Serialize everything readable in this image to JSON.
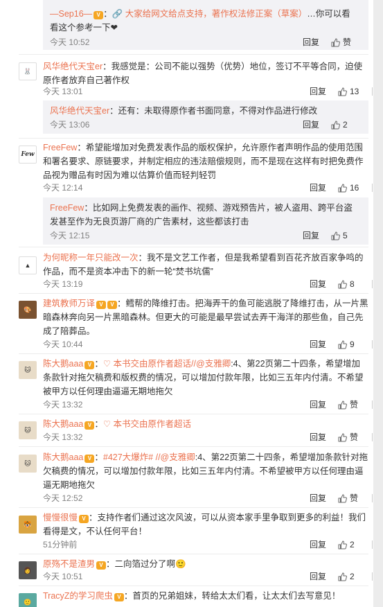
{
  "comments": [
    {
      "id": "c0-sub",
      "is_sub": true,
      "user": "—Sep16—",
      "link": "🔗 大家给网文给点支持，著作权法修正案（草案）",
      "text": "…你可以看看这个参考一下❤",
      "time": "今天 10:52",
      "reply": "回复",
      "likes": "赞"
    },
    {
      "id": "c1",
      "user": "风华绝代天宝er",
      "text": "：我感觉是：公司不能以强势（优势）地位，签订不平等合同，迫使原作者放弃自己著作权",
      "time": "今天 13:01",
      "reply": "回复",
      "likes": "13"
    },
    {
      "id": "c1-sub",
      "is_sub": true,
      "user": "风华绝代天宝er",
      "text": "：还有：未取得原作者书面同意，不得对作品进行修改",
      "time": "今天 13:06",
      "reply": "回复",
      "likes": "2"
    },
    {
      "id": "c2",
      "user": "FreeFew",
      "text": "：希望能增加对免费发表作品的版权保护，允许原作者声明作品的使用范围和署名要求、原链要求，并制定相应的违法赔偿规则，而不是现在这样有时把免费作品视为赠品有时因为难以估算价值而轻判轻罚",
      "time": "今天 12:14",
      "reply": "回复",
      "likes": "16"
    },
    {
      "id": "c2-sub",
      "is_sub": true,
      "user": "FreeFew",
      "text": "：比如网上免费发表的画作、视频、游戏预告片，被人盗用、跨平台盗发甚至作为无良页游厂商的广告素材，这些都该打击",
      "time": "今天 12:15",
      "reply": "回复",
      "likes": "5"
    },
    {
      "id": "c3",
      "user": "为何昵称一年只能改一次",
      "text": "：我不是文艺工作者，但是我希望看到百花齐放百家争鸣的作品，而不是资本冲击下的新一轮“焚书坑儒”",
      "time": "今天 13:19",
      "reply": "回复",
      "likes": "8"
    },
    {
      "id": "c4",
      "user": "建筑教师万译",
      "text": "：鳕帮的降维打击。把海弄干的鱼可能逃脱了降维打击，从一片黑暗森林奔向另一片黑暗森林。但更大的可能是最早尝试去弄干海洋的那些鱼，自己先成了陪葬品。",
      "time": "今天 10:44",
      "reply": "回复",
      "likes": "9"
    },
    {
      "id": "c5",
      "user": "陈大鹅aaa",
      "link": "♡ 本书交由原作者超话//@支雅卿",
      "text": ":4、第22页第二十四条，希望增加条款针对拖欠稿费和版权费的情况，可以增加付款年限，比如三五年内付清。不希望被甲方以任何理由逼逼无期地拖欠",
      "time": "今天 13:32",
      "reply": "回复",
      "likes": "赞"
    },
    {
      "id": "c6",
      "user": "陈大鹅aaa",
      "link": "♡ 本书交由原作者超话",
      "text": "",
      "time": "今天 13:32",
      "reply": "回复",
      "likes": "赞"
    },
    {
      "id": "c7",
      "user": "陈大鹅aaa",
      "link": "#427大爆炸# //@支雅卿",
      "text": ":4、第22页第二十四条，希望增加条款针对拖欠稿费的情况，可以增加付款年限，比如三五年内付清。不希望被甲方以任何理由逼逼无期地拖欠",
      "time": "今天 12:52",
      "reply": "回复",
      "likes": "赞"
    },
    {
      "id": "c8",
      "user": "慢慢很慢",
      "text": "：支持作者们通过这次风波，可以从资本家手里争取到更多的利益！我们看得是文，不认任何平台！",
      "time": "51分钟前",
      "reply": "回复",
      "likes": "2"
    },
    {
      "id": "c9",
      "user": "原殇不是渣男",
      "text": "：二向箔过分了啊🙂",
      "time": "今天 10:51",
      "reply": "回复",
      "likes": "2"
    },
    {
      "id": "c10",
      "user": "TracyZ的学习爬虫",
      "text": "：首页的兄弟姐妹，转给太太们看，让太太们去写意见！",
      "time": "",
      "reply": "",
      "likes": ""
    }
  ],
  "avatars": {
    "c1": "🐰",
    "c2": "Few",
    "c3": "▲",
    "c4": "🎨",
    "c5": "🐱",
    "c6": "🐱",
    "c7": "🐱",
    "c8": "🐯",
    "c9": "👩",
    "c10": "🙂"
  },
  "colors": {
    "accent": "#eb7350",
    "sub_bg": "#f2f2f5",
    "meta": "#808080"
  }
}
